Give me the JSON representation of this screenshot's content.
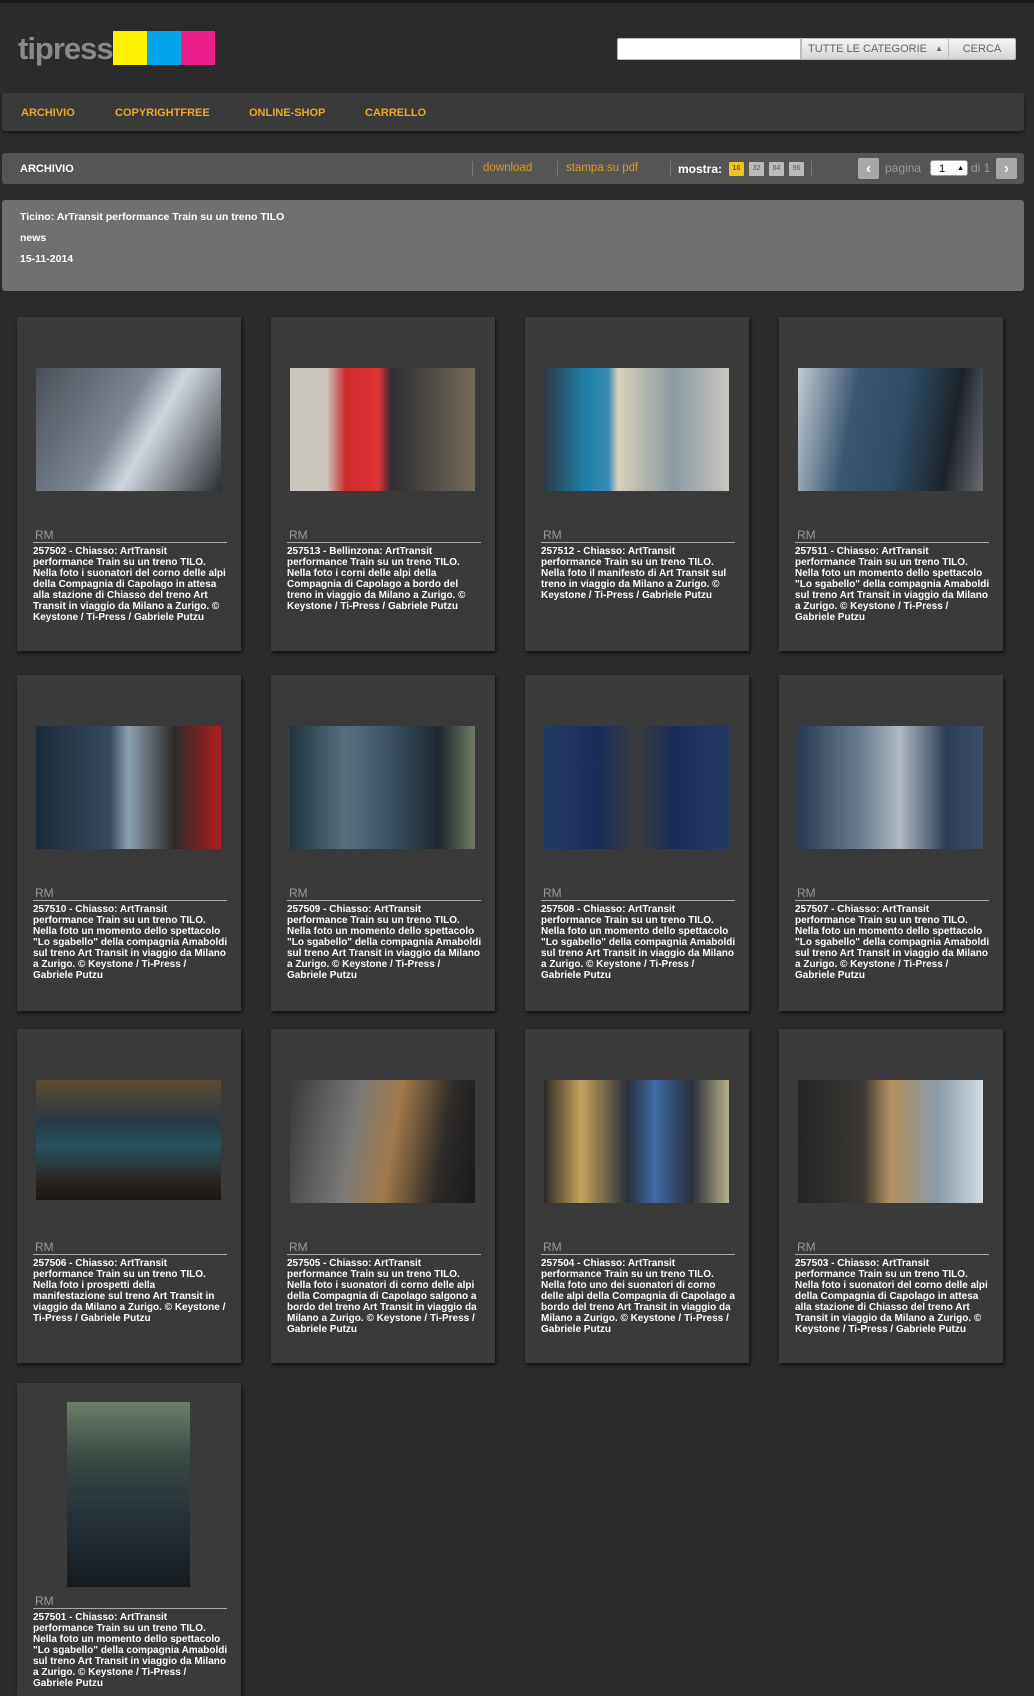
{
  "header": {
    "logo_text": "tipress",
    "logo_colors": [
      "#fff200",
      "#00a4e8",
      "#ec1f8d"
    ],
    "search": {
      "placeholder": "",
      "category": "TUTTE LE CATEGORIE",
      "button": "CERCA"
    }
  },
  "nav": {
    "items": [
      "ARCHIVIO",
      "COPYRIGHTFREE",
      "ONLINE-SHOP",
      "CARRELLO"
    ]
  },
  "toolbar": {
    "section": "ARCHIVIO",
    "download": "download",
    "print_pdf": "stampa su pdf",
    "show_label": "mostra:",
    "sizes": [
      "16",
      "32",
      "64",
      "96"
    ],
    "selected_size": "16",
    "page_label": "pagina",
    "page_value": "1",
    "of_label": "di 1"
  },
  "info": {
    "title": "Ticino: ArTransit performance Train su un treno TILO",
    "category": "news",
    "date": "15-11-2014"
  },
  "accent_color": "#e9a92a",
  "cards": [
    {
      "rights": "RM",
      "caption": "257502 - Chiasso: ArtTransit performance Train su un treno TILO. Nella foto i suonatori del corno delle alpi della Compagnia di Capolago in attesa alla stazione di Chiasso del treno Art Transit in viaggio da Milano a Zurigo. © Keystone / Ti-Press / Gabriele Putzu"
    },
    {
      "rights": "RM",
      "caption": "257513 - Bellinzona: ArtTransit performance Train su un treno TILO. Nella foto i corni delle alpi della Compagnia di Capolago a bordo del treno in viaggio da Milano a Zurigo. © Keystone / Ti-Press / Gabriele Putzu"
    },
    {
      "rights": "RM",
      "caption": "257512 - Chiasso: ArtTransit performance Train su un treno TILO. Nella foto il manifesto di Art Transit sul treno in viaggio da Milano a Zurigo. © Keystone / Ti-Press / Gabriele Putzu"
    },
    {
      "rights": "RM",
      "caption": "257511 - Chiasso: ArtTransit performance Train su un treno TILO. Nella foto un momento dello spettacolo \"Lo sgabello\" della compagnia Amaboldi sul treno Art Transit in viaggio da Milano a Zurigo. © Keystone / Ti-Press / Gabriele Putzu"
    },
    {
      "rights": "RM",
      "caption": "257510 - Chiasso: ArtTransit performance Train su un treno TILO. Nella foto un momento dello spettacolo \"Lo sgabello\" della compagnia Amaboldi sul treno Art Transit in viaggio da Milano a Zurigo. © Keystone / Ti-Press / Gabriele Putzu"
    },
    {
      "rights": "RM",
      "caption": "257509 - Chiasso: ArtTransit performance Train su un treno TILO. Nella foto un momento dello spettacolo \"Lo sgabello\" della compagnia Amaboldi sul treno Art Transit in viaggio da Milano a Zurigo. © Keystone / Ti-Press / Gabriele Putzu"
    },
    {
      "rights": "RM",
      "caption": "257508 - Chiasso: ArtTransit performance Train su un treno TILO. Nella foto un momento dello spettacolo \"Lo sgabello\" della compagnia Amaboldi sul treno Art Transit in viaggio da Milano a Zurigo. © Keystone / Ti-Press / Gabriele Putzu"
    },
    {
      "rights": "RM",
      "caption": "257507 - Chiasso: ArtTransit performance Train su un treno TILO. Nella foto un momento dello spettacolo \"Lo sgabello\" della compagnia Amaboldi sul treno Art Transit in viaggio da Milano a Zurigo. © Keystone / Ti-Press / Gabriele Putzu"
    },
    {
      "rights": "RM",
      "caption": "257506 - Chiasso: ArtTransit performance Train su un treno TILO. Nella foto i prospetti della manifestazione sul treno Art Transit in viaggio da Milano a Zurigo. © Keystone / Ti-Press / Gabriele Putzu"
    },
    {
      "rights": "RM",
      "caption": "257505 - Chiasso: ArtTransit performance Train su un treno TILO. Nella foto i suonatori di corno delle alpi della Compagnia di Capolago salgono a bordo del treno Art Transit in viaggio da Milano a Zurigo. © Keystone / Ti-Press / Gabriele Putzu"
    },
    {
      "rights": "RM",
      "caption": "257504 - Chiasso: ArtTransit performance Train su un treno TILO. Nella foto uno dei suonatori di corno delle alpi della Compagnia di Capolago a bordo del treno Art Transit in viaggio da Milano a Zurigo. © Keystone / Ti-Press / Gabriele Putzu"
    },
    {
      "rights": "RM",
      "caption": "257503 - Chiasso: ArtTransit performance Train su un treno TILO. Nella foto i suonatori del corno delle alpi della Compagnia di Capolago in attesa alla stazione di Chiasso del treno Art Transit in viaggio da Milano a Zurigo. © Keystone / Ti-Press / Gabriele Putzu"
    },
    {
      "rights": "RM",
      "caption": "257501 - Chiasso: ArtTransit performance Train su un treno TILO. Nella foto un momento dello spettacolo \"Lo sgabello\" della compagnia Amaboldi sul treno Art Transit in viaggio da Milano a Zurigo. © Keystone / Ti-Press / Gabriele Putzu"
    }
  ]
}
